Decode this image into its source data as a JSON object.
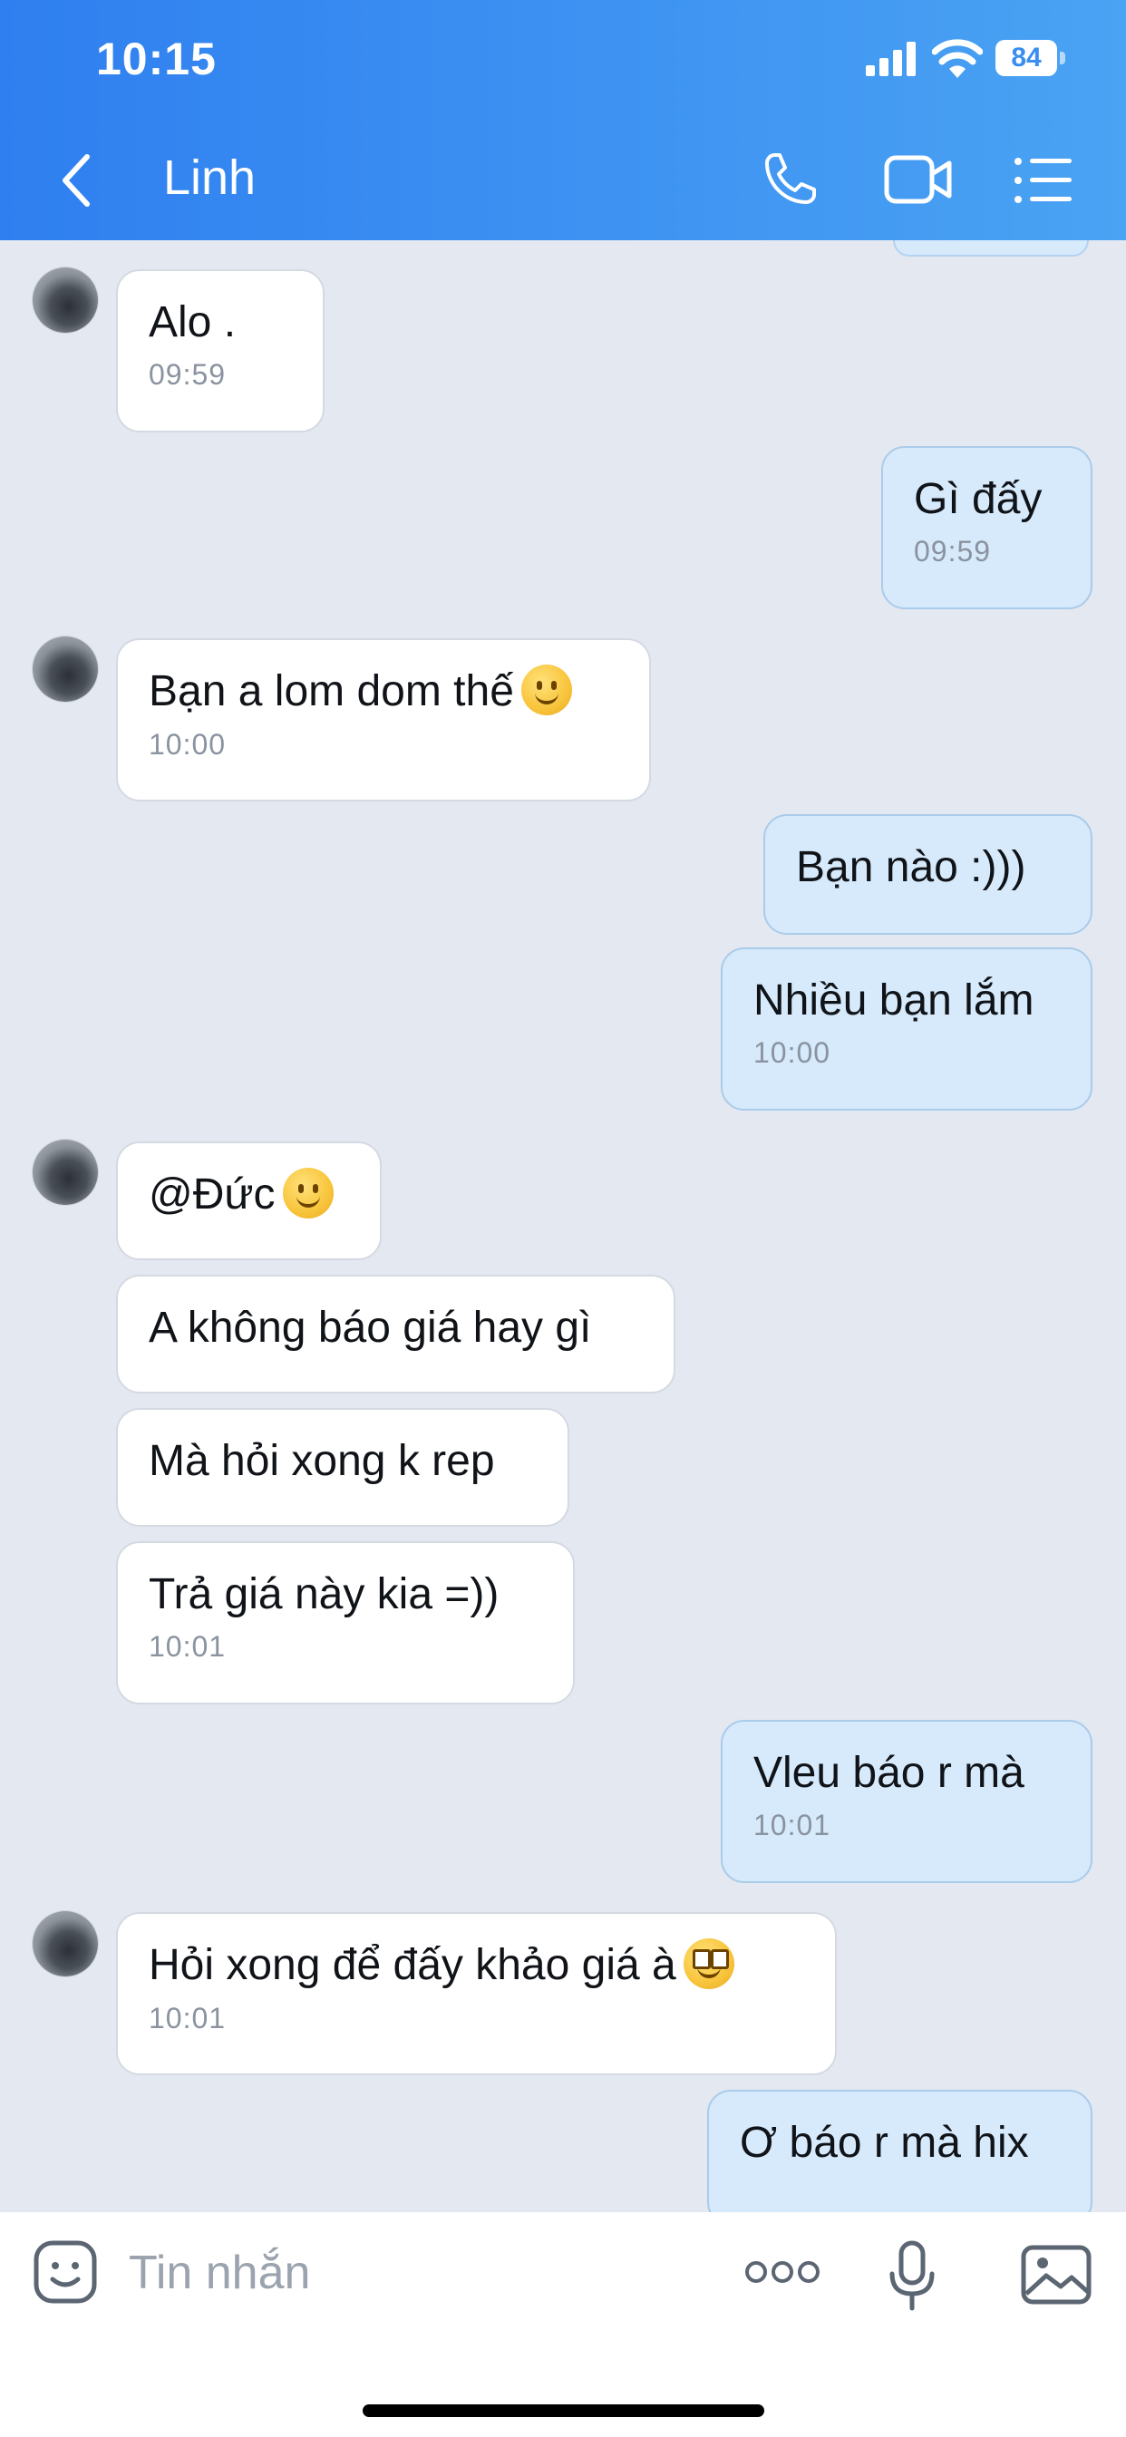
{
  "status_bar": {
    "time": "10:15",
    "battery": "84"
  },
  "header": {
    "title": "Linh"
  },
  "messages": [
    {
      "text": "Alo .",
      "time": "09:59"
    },
    {
      "text": "Gì đấy",
      "time": "09:59"
    },
    {
      "text": "Bạn a lom dom thế",
      "time": "10:00"
    },
    {
      "text": "Bạn nào :)))"
    },
    {
      "text": "Nhiều bạn lắm",
      "time": "10:00"
    },
    {
      "text": "@Đức"
    },
    {
      "text": "A không báo giá hay gì"
    },
    {
      "text": "Mà hỏi xong k rep"
    },
    {
      "text": "Trả giá này kia =))",
      "time": "10:01"
    },
    {
      "text": "Vleu báo r mà",
      "time": "10:01"
    },
    {
      "text": "Hỏi xong để đấy khảo giá à",
      "time": "10:01"
    },
    {
      "text": "Ơ báo r mà hix"
    }
  ],
  "composer": {
    "placeholder": "Tin nhắn"
  },
  "colors": {
    "header_start": "#2f7ff0",
    "header_end": "#4aa3f3",
    "chat_background": "#e3e8f1",
    "incoming_bubble": "#ffffff",
    "outgoing_bubble": "#d6eafb"
  },
  "icons": [
    "back-arrow-icon",
    "phone-icon",
    "video-camera-icon",
    "list-menu-icon",
    "sticker-icon",
    "more-dots-icon",
    "microphone-icon",
    "image-icon",
    "smile-emoji-icon",
    "goofy-emoji-icon"
  ]
}
